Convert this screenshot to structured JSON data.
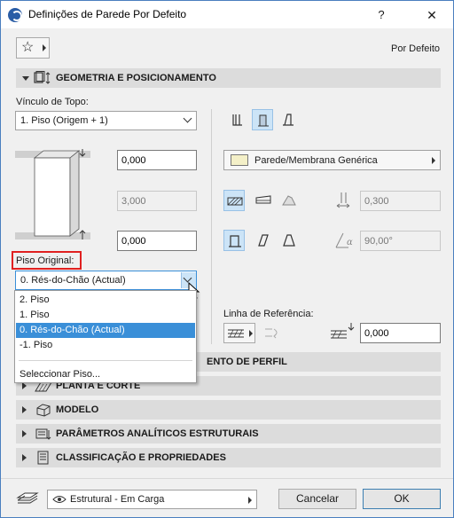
{
  "window": {
    "title": "Definições de Parede Por Defeito",
    "help": "?",
    "close": "✕"
  },
  "header": {
    "favorites_icon": "star-icon",
    "default_label": "Por Defeito"
  },
  "geometry": {
    "section_title": "GEOMETRIA E POSICIONAMENTO",
    "top_link_label": "Vínculo de Topo:",
    "top_link_value": "1. Piso (Origem + 1)",
    "top_offset": "0,000",
    "height": "3,000",
    "bottom_offset": "0,000",
    "home_story_label": "Piso Original:",
    "home_story_value": "0. Rés-do-Chão (Actual)",
    "home_story_options": [
      "2. Piso",
      "1. Piso",
      "0. Rés-do-Chão (Actual)",
      "-1. Piso"
    ],
    "select_story": "Seleccionar Piso...",
    "material": "Parede/Membrana Genérica",
    "thickness": "0,300",
    "angle": "90,00°",
    "ref_line_label": "Linha de Referência:",
    "ref_offset": "0,000"
  },
  "sections": {
    "profile": "ENTO DE PERFIL",
    "floor_plan": "PLANTA E CORTE",
    "model": "MODELO",
    "structural": "PARÂMETROS ANALÍTICOS ESTRUTURAIS",
    "classification": "CLASSIFICAÇÃO E PROPRIEDADES"
  },
  "footer": {
    "layer": "Estrutural - Em Carga",
    "cancel": "Cancelar",
    "ok": "OK"
  },
  "colors": {
    "accent": "#3a8fd8",
    "highlight_box": "#e02020",
    "selected_tool": "#cce4f7"
  }
}
